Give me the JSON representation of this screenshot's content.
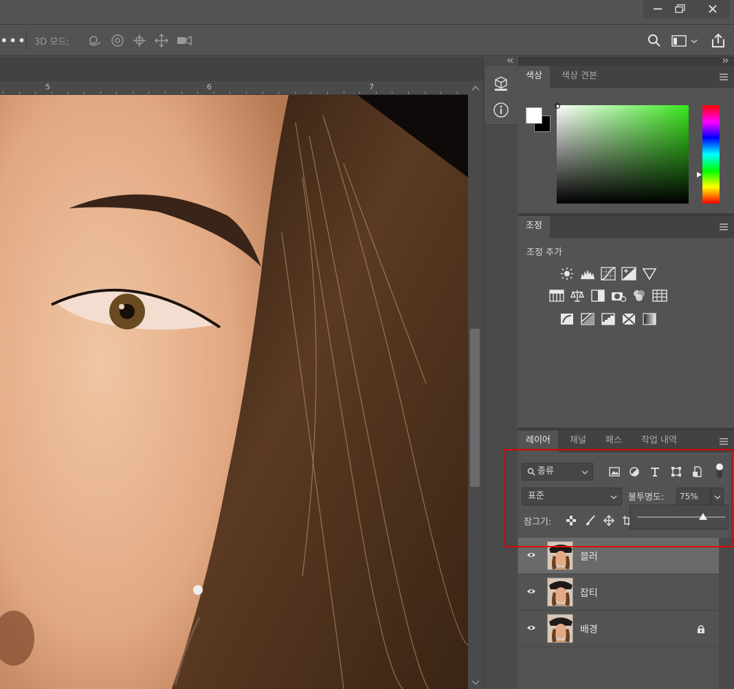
{
  "options_bar": {
    "mode_label": "3D 모드:"
  },
  "ruler": {
    "labels": [
      "5",
      "6",
      "7"
    ]
  },
  "color_panel": {
    "tabs": [
      "색상",
      "색상 견본"
    ],
    "foreground": "#ffffff",
    "background": "#000000"
  },
  "adjust_panel": {
    "tab": "조정",
    "add_label": "조정 추가"
  },
  "layers_panel": {
    "tabs": [
      "레이어",
      "채널",
      "패스",
      "작업 내역"
    ],
    "filter_kind": "종류",
    "blend_mode": "표준",
    "opacity_label": "불투명도:",
    "opacity_value": "75%",
    "opacity_slider": 0.75,
    "lock_label": "잠그기:",
    "layers": [
      {
        "name": "블러",
        "selected": true,
        "locked": false
      },
      {
        "name": "잡티",
        "selected": false,
        "locked": false
      },
      {
        "name": "배경",
        "selected": false,
        "locked": true
      }
    ]
  },
  "colors": {
    "highlight": "#e00000",
    "panel_bg": "#535353"
  }
}
